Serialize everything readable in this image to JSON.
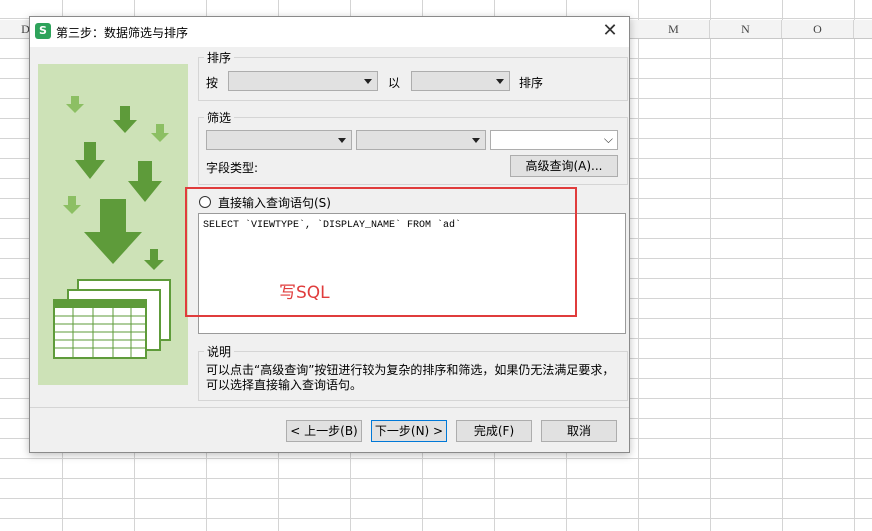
{
  "spreadsheet": {
    "columns": [
      "D",
      "",
      "",
      "",
      "",
      "",
      "",
      "",
      "",
      "M",
      "N",
      "O"
    ]
  },
  "dialog": {
    "title": "第三步：数据筛选与排序",
    "app_icon_text": "S",
    "close_glyph": "✕",
    "sort": {
      "group_label": "排序",
      "by_label": "按",
      "field_value": "",
      "with_label": "以",
      "order_value": "",
      "suffix_label": "排序"
    },
    "filter": {
      "group_label": "筛选",
      "field_value": "",
      "operator_value": "",
      "value_value": "",
      "field_type_label": "字段类型:",
      "advanced_button": "高级查询(A)..."
    },
    "direct_query": {
      "radio_label": "直接输入查询语句(S)",
      "sql": "SELECT `VIEWTYPE`, `DISPLAY_NAME` FROM `ad`"
    },
    "annotation": "写SQL",
    "description": {
      "group_label": "说明",
      "text": "可以点击“高级查询”按钮进行较为复杂的排序和筛选，如果仍无法满足要求，可以选择直接输入查询语句。"
    },
    "buttons": {
      "prev": "< 上一步(B)",
      "next": "下一步(N) >",
      "finish": "完成(F)",
      "cancel": "取消"
    }
  },
  "colors": {
    "illustration_bg": "#cde2b7",
    "arrow_dark": "#5e9b3a",
    "arrow_light": "#8cbf63",
    "annotation_red": "#e03c3c"
  }
}
